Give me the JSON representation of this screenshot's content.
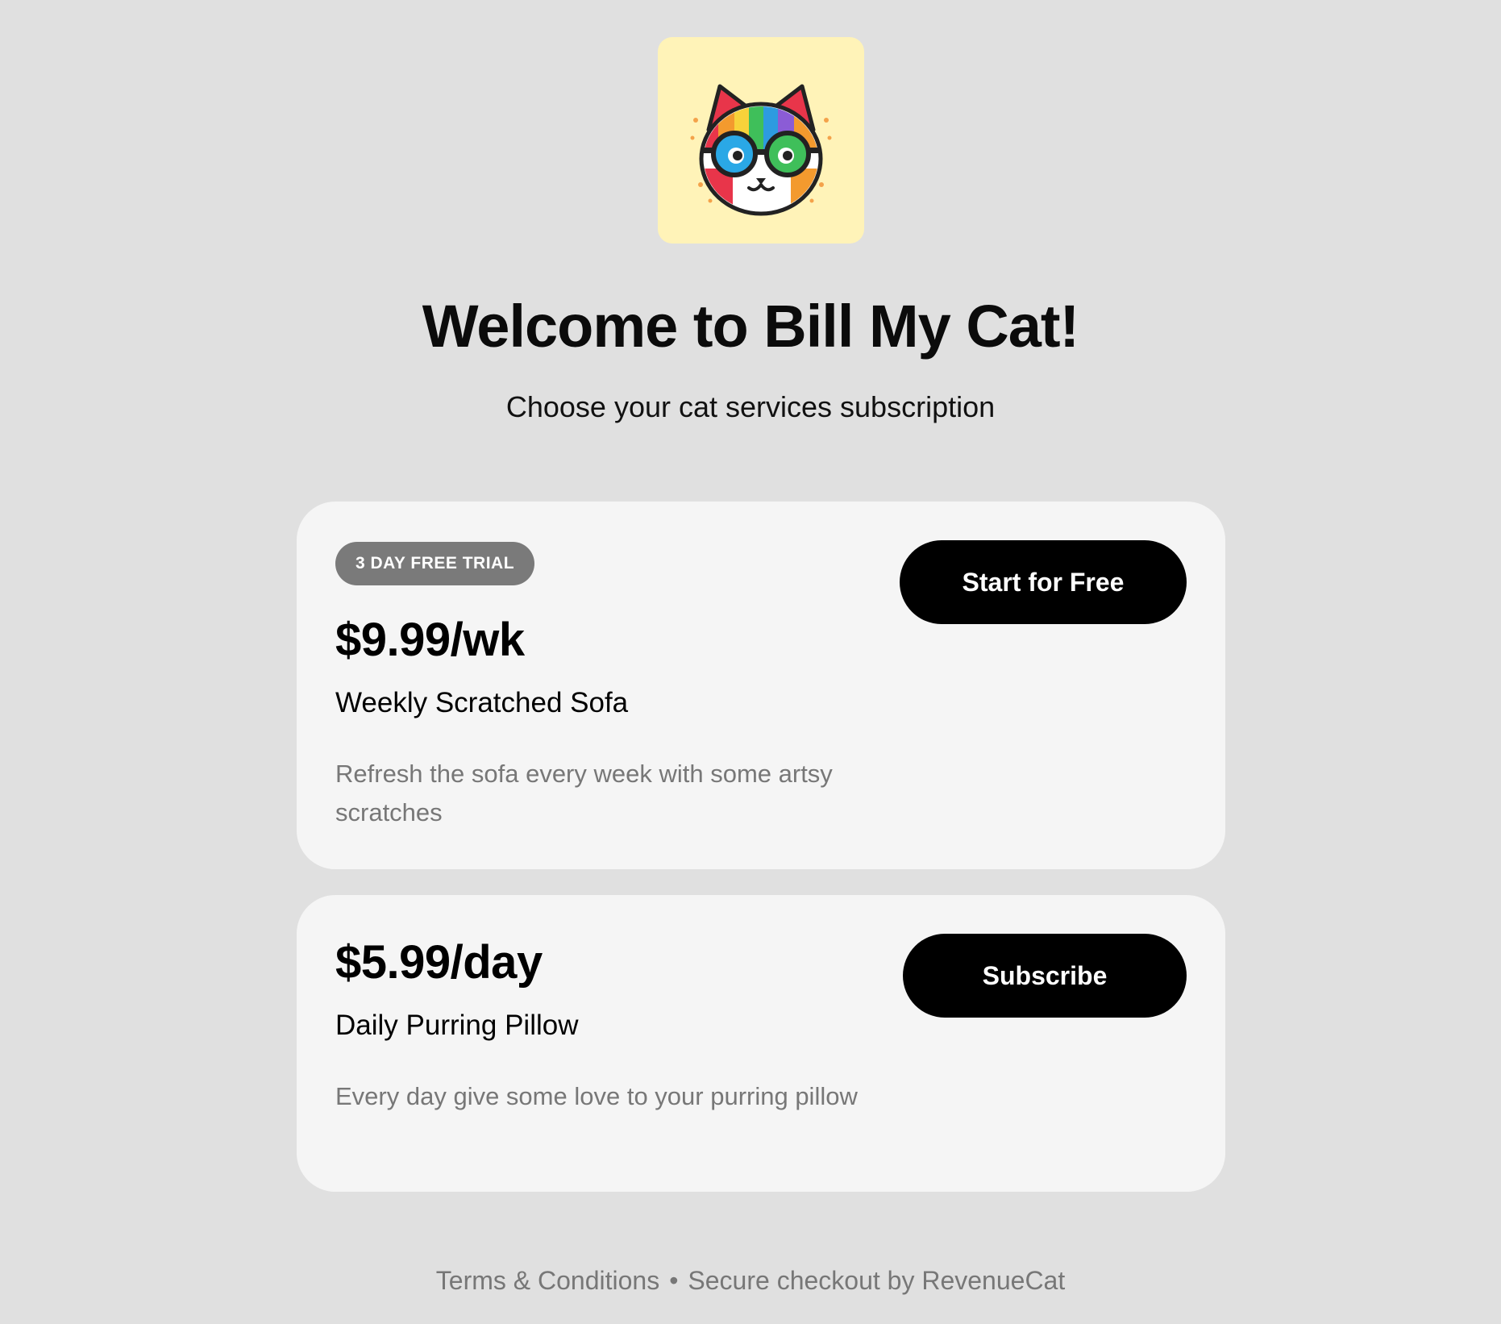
{
  "header": {
    "logo_icon": "cat-with-glasses-icon",
    "title": "Welcome to Bill My Cat!",
    "subtitle": "Choose your cat services subscription"
  },
  "plans": [
    {
      "badge": "3 DAY FREE TRIAL",
      "price": "$9.99/wk",
      "name": "Weekly Scratched Sofa",
      "description": "Refresh the sofa every week with some artsy scratches",
      "button_label": "Start for Free"
    },
    {
      "price": "$5.99/day",
      "name": "Daily Purring Pillow",
      "description": "Every day give some love to your purring pillow",
      "button_label": "Subscribe"
    }
  ],
  "footer": {
    "terms_label": "Terms & Conditions",
    "separator": "•",
    "secure_label": "Secure checkout by RevenueCat"
  },
  "colors": {
    "background": "#e0e0e0",
    "card": "#f5f5f5",
    "logo_tile": "#fff3b8",
    "button": "#000000",
    "badge": "#7a7a7a",
    "muted_text": "#777777"
  }
}
